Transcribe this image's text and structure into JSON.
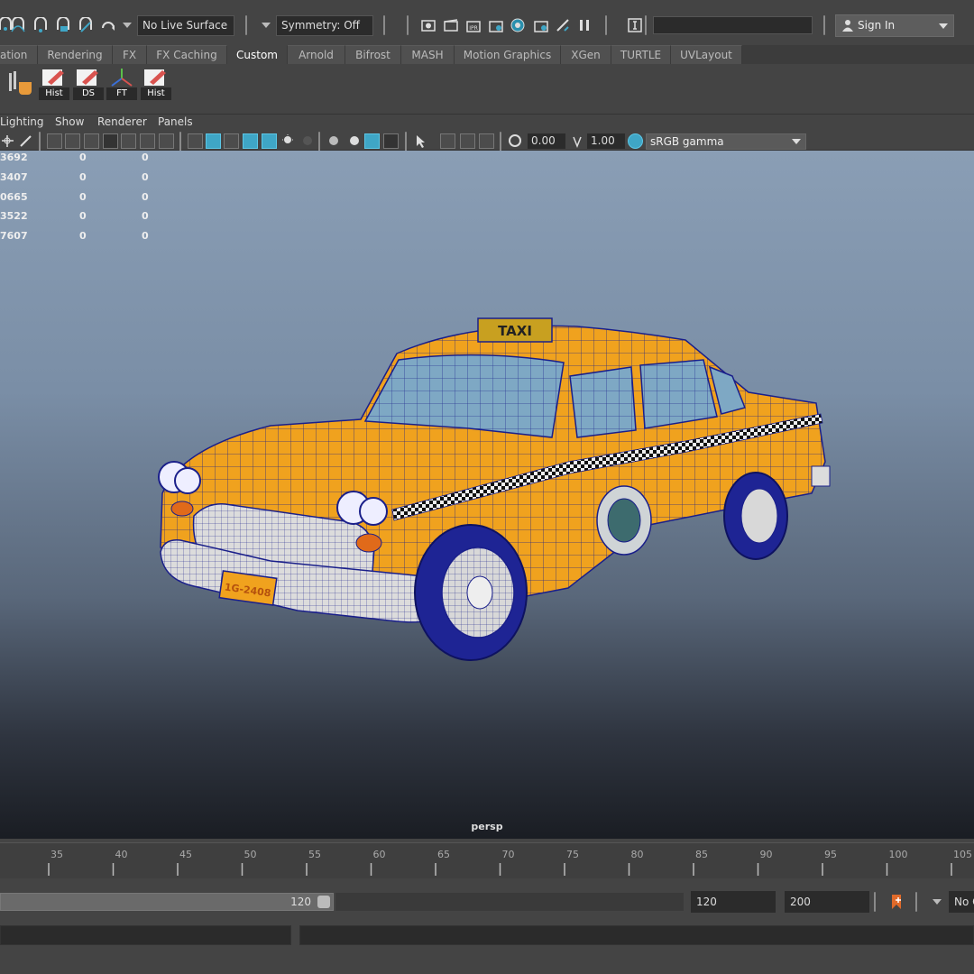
{
  "status_line": {
    "live_surface": "No Live Surface",
    "symmetry": "Symmetry: Off",
    "sign_in": "Sign In"
  },
  "shelf_tabs": [
    {
      "label": "ation"
    },
    {
      "label": "Rendering"
    },
    {
      "label": "FX"
    },
    {
      "label": "FX Caching"
    },
    {
      "label": "Custom"
    },
    {
      "label": "Arnold"
    },
    {
      "label": "Bifrost"
    },
    {
      "label": "MASH"
    },
    {
      "label": "Motion Graphics"
    },
    {
      "label": "XGen"
    },
    {
      "label": "TURTLE"
    },
    {
      "label": "UVLayout"
    }
  ],
  "active_shelf_tab": "Custom",
  "shelf_buttons": [
    {
      "label": "Hist",
      "icon": "pencil-paper-icon"
    },
    {
      "label": "DS",
      "icon": "pencil-paper-icon"
    },
    {
      "label": "FT",
      "icon": "axes-icon"
    },
    {
      "label": "Hist",
      "icon": "pencil-paper-icon"
    }
  ],
  "panel_menu": [
    "Lighting",
    "Show",
    "Renderer",
    "Panels"
  ],
  "panel_toolbar": {
    "exposure": "0.00",
    "gamma": "1.00",
    "color_space": "sRGB gamma"
  },
  "hud_rows": [
    {
      "a": "3692",
      "b": "0",
      "c": "0"
    },
    {
      "a": "3407",
      "b": "0",
      "c": "0"
    },
    {
      "a": "0665",
      "b": "0",
      "c": "0"
    },
    {
      "a": "3522",
      "b": "0",
      "c": "0"
    },
    {
      "a": "7607",
      "b": "0",
      "c": "0"
    }
  ],
  "viewport": {
    "camera": "persp",
    "taxi_sign": "TAXI",
    "plate": "1G-2408"
  },
  "time_slider": {
    "labels": [
      "35",
      "40",
      "45",
      "50",
      "55",
      "60",
      "65",
      "70",
      "75",
      "80",
      "85",
      "90",
      "95",
      "100",
      "105"
    ]
  },
  "range_slider": {
    "bar_value": "120",
    "end_time": "120",
    "anim_end": "200",
    "no_char": "No C"
  },
  "colors": {
    "accent": "#3fa6c6",
    "taxi_yellow": "#f0a21e",
    "wire_blue": "#1a1f8a",
    "keyframe_orange": "#e06a2a"
  }
}
